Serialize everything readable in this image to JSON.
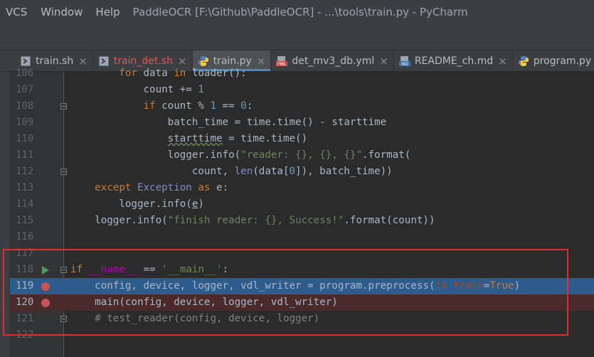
{
  "menubar": {
    "items": [
      "VCS",
      "Window",
      "Help"
    ],
    "title": "PaddleOCR [F:\\Github\\PaddleOCR] - ...\\tools\\train.py - PyCharm"
  },
  "tabs": [
    {
      "label": "train.sh",
      "icon": "shell-script-icon",
      "state": "normal"
    },
    {
      "label": "train_det.sh",
      "icon": "shell-script-icon",
      "state": "error"
    },
    {
      "label": "train.py",
      "icon": "python-file-icon",
      "state": "active"
    },
    {
      "label": "det_mv3_db.yml",
      "icon": "yaml-file-icon",
      "state": "normal"
    },
    {
      "label": "README_ch.md",
      "icon": "markdown-file-icon",
      "state": "normal"
    },
    {
      "label": "program.py",
      "icon": "python-file-icon",
      "state": "normal"
    }
  ],
  "close_glyph": "×",
  "editor": {
    "lines": [
      {
        "num": "106",
        "text": "        for data in loader():"
      },
      {
        "num": "107",
        "text": "            count += 1"
      },
      {
        "num": "108",
        "text": "            if count % 1 == 0:"
      },
      {
        "num": "109",
        "text": "                batch_time = time.time() - starttime"
      },
      {
        "num": "110",
        "text": "                starttime = time.time()"
      },
      {
        "num": "111",
        "text": "                logger.info(\"reader: {}, {}, {}\".format("
      },
      {
        "num": "112",
        "text": "                    count, len(data[0]), batch_time))"
      },
      {
        "num": "113",
        "text": "    except Exception as e:"
      },
      {
        "num": "114",
        "text": "        logger.info(e)"
      },
      {
        "num": "115",
        "text": "    logger.info(\"finish reader: {}, Success!\".format(count))"
      },
      {
        "num": "116",
        "text": ""
      },
      {
        "num": "117",
        "text": ""
      },
      {
        "num": "118",
        "text": "if __name__ == '__main__':"
      },
      {
        "num": "119",
        "text": "    config, device, logger, vdl_writer = program.preprocess(is_train=True)"
      },
      {
        "num": "120",
        "text": "    main(config, device, logger, vdl_writer)"
      },
      {
        "num": "121",
        "text": "    # test_reader(config, device, logger)"
      },
      {
        "num": "122",
        "text": ""
      }
    ]
  },
  "colors": {
    "background": "#2b2b2b",
    "keyword": "#cc7832",
    "string": "#6a8759",
    "number": "#6897bb",
    "comment": "#808080",
    "execution_line": "#2d5b8c",
    "breakpoint_line": "#4b2a2b",
    "breakpoint": "#c75450",
    "highlight_box": "#e02e2e"
  }
}
